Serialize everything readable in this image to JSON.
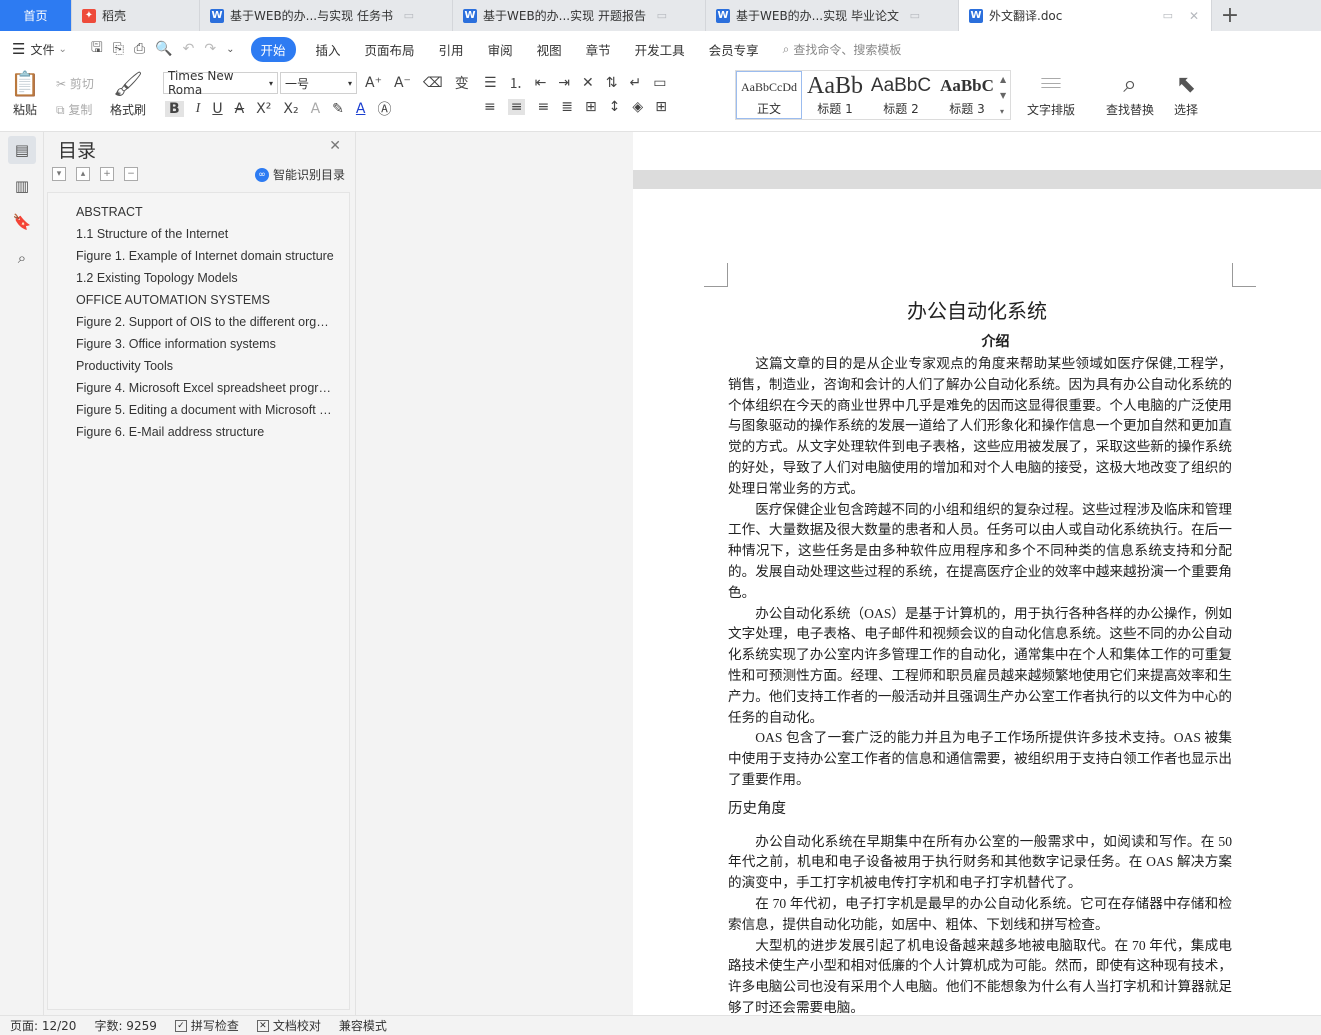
{
  "tabs": {
    "home": "首页",
    "daoke": "稻壳",
    "docs": [
      {
        "label": "基于WEB的办...与实现 任务书"
      },
      {
        "label": "基于WEB的办...实现 开题报告"
      },
      {
        "label": "基于WEB的办...实现 毕业论文"
      },
      {
        "label": "外文翻译.doc"
      }
    ],
    "add": "+"
  },
  "menu": {
    "file": "文件",
    "items": [
      "开始",
      "插入",
      "页面布局",
      "引用",
      "审阅",
      "视图",
      "章节",
      "开发工具",
      "会员专享"
    ],
    "search": "查找命令、搜索模板"
  },
  "ribbon": {
    "paste": "粘贴",
    "cut": "剪切",
    "copy": "复制",
    "format_painter": "格式刷",
    "font_name": "Times New Roma",
    "font_size": "一号",
    "styles": [
      {
        "preview": "AaBbCcDd",
        "name": "正文"
      },
      {
        "preview": "AaBb",
        "name": "标题 1"
      },
      {
        "preview": "AaBbC",
        "name": "标题 2"
      },
      {
        "preview": "AaBbC",
        "name": "标题 3"
      }
    ],
    "text_layout": "文字排版",
    "find_replace": "查找替换",
    "select": "选择"
  },
  "toc": {
    "title": "目录",
    "smart": "智能识别目录",
    "items": [
      "ABSTRACT",
      "1.1 Structure of the Internet",
      "Figure 1. Example of Internet domain structure",
      "1.2 Existing Topology Models",
      "OFFICE AUTOMATION SYSTEMS",
      "Figure 2. Support of OIS to the different organizational levels",
      "Figure 3. Office information systems",
      "Productivity Tools",
      "Figure 4. Microsoft Excel spreadsheet program",
      "Figure 5. Editing a document with Microsoft Word",
      "Figure 6. E-Mail address structure"
    ]
  },
  "doc": {
    "title": "办公自动化系统",
    "subtitle": "介绍",
    "paragraphs": [
      "这篇文章的目的是从企业专家观点的角度来帮助某些领域如医疗保健,工程学，销售，制造业，咨询和会计的人们了解办公自动化系统。因为具有办公自动化系统的个体组织在今天的商业世界中几乎是难免的因而这显得很重要。个人电脑的广泛使用与图象驱动的操作系统的发展一道给了人们形象化和操作信息一个更加自然和更加直觉的方式。从文字处理软件到电子表格，这些应用被发展了，采取这些新的操作系统的好处，导致了人们对电脑使用的增加和对个人电脑的接受，这极大地改变了组织的处理日常业务的方式。",
      "医疗保健企业包含跨越不同的小组和组织的复杂过程。这些过程涉及临床和管理工作、大量数据及很大数量的患者和人员。任务可以由人或自动化系统执行。在后一种情况下，这些任务是由多种软件应用程序和多个不同种类的信息系统支持和分配的。发展自动处理这些过程的系统，在提高医疗企业的效率中越来越扮演一个重要角色。",
      "办公自动化系统（OAS）是基于计算机的，用于执行各种各样的办公操作，例如文字处理，电子表格、电子邮件和视频会议的自动化信息系统。这些不同的办公自动化系统实现了办公室内许多管理工作的自动化，通常集中在个人和集体工作的可重复性和可预测性方面。经理、工程师和职员雇员越来越频繁地使用它们来提高效率和生产力。他们支持工作者的一般活动并且强调生产办公室工作者执行的以文件为中心的任务的自动化。",
      "OAS 包含了一套广泛的能力并且为电子工作场所提供许多技术支持。OAS 被集中使用于支持办公室工作者的信息和通信需要，被组织用于支持白领工作者也显示出了重要作用。"
    ],
    "section2": "历史角度",
    "paragraphs2": [
      "办公自动化系统在早期集中在所有办公室的一般需求中，如阅读和写作。在 50 年代之前，机电和电子设备被用于执行财务和其他数字记录任务。在 OAS 解决方案的演变中，手工打字机被电传打字机和电子打字机替代了。",
      "在 70 年代初，电子打字机是最早的办公自动化系统。它可在存储器中存储和检索信息，提供自动化功能，如居中、粗体、下划线和拼写检查。",
      "大型机的进步发展引起了机电设备越来越多地被电脑取代。在 70 年代，集成电路技术使生产小型和相对低廉的个人计算机成为可能。然而，即使有这种现有技术，许多电脑公司也没有采用个人电脑。他们不能想象为什么有人当打字机和计算器就足够了时还会需要电脑。"
    ]
  },
  "status": {
    "page": "页面: 12/20",
    "words": "字数: 9259",
    "spell": "拼写检查",
    "proof": "文档校对",
    "compat": "兼容模式"
  }
}
